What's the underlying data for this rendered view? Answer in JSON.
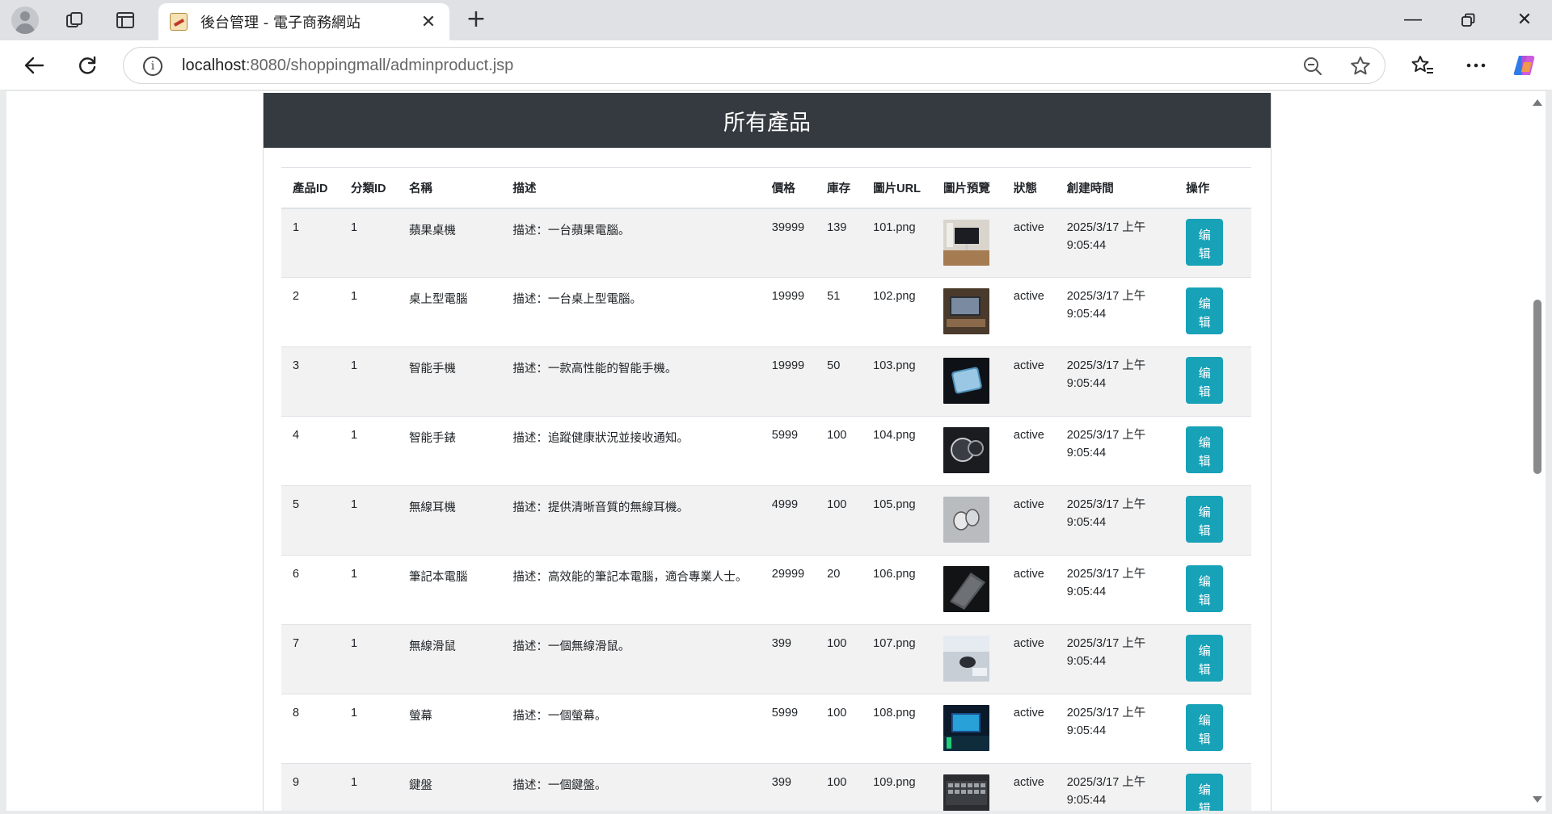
{
  "browser": {
    "tab_title": "後台管理 - 電子商務網站",
    "url_host": "localhost",
    "url_rest": ":8080/shoppingmall/adminproduct.jsp"
  },
  "page": {
    "heading": "所有產品"
  },
  "table": {
    "headers": [
      "產品ID",
      "分類ID",
      "名稱",
      "描述",
      "價格",
      "庫存",
      "圖片URL",
      "圖片預覽",
      "狀態",
      "創建時間",
      "操作"
    ],
    "rows": [
      {
        "id": "1",
        "cat": "1",
        "name": "蘋果桌機",
        "desc": "描述：一台蘋果電腦。",
        "price": "39999",
        "stock": "139",
        "img": "101.png",
        "status": "active",
        "time1": "2025/3/17 上午",
        "time2": "9:05:44",
        "action": "编辑",
        "thumb": "desk-photo-thumbnail"
      },
      {
        "id": "2",
        "cat": "1",
        "name": "桌上型電腦",
        "desc": "描述：一台桌上型電腦。",
        "price": "19999",
        "stock": "51",
        "img": "102.png",
        "status": "active",
        "time1": "2025/3/17 上午",
        "time2": "9:05:44",
        "action": "编辑",
        "thumb": "laptop-photo-thumbnail"
      },
      {
        "id": "3",
        "cat": "1",
        "name": "智能手機",
        "desc": "描述：一款高性能的智能手機。",
        "price": "19999",
        "stock": "50",
        "img": "103.png",
        "status": "active",
        "time1": "2025/3/17 上午",
        "time2": "9:05:44",
        "action": "编辑",
        "thumb": "phone-photo-thumbnail"
      },
      {
        "id": "4",
        "cat": "1",
        "name": "智能手錶",
        "desc": "描述：追蹤健康狀況並接收通知。",
        "price": "5999",
        "stock": "100",
        "img": "104.png",
        "status": "active",
        "time1": "2025/3/17 上午",
        "time2": "9:05:44",
        "action": "编辑",
        "thumb": "watch-photo-thumbnail"
      },
      {
        "id": "5",
        "cat": "1",
        "name": "無線耳機",
        "desc": "描述：提供清晰音質的無線耳機。",
        "price": "4999",
        "stock": "100",
        "img": "105.png",
        "status": "active",
        "time1": "2025/3/17 上午",
        "time2": "9:05:44",
        "action": "编辑",
        "thumb": "earbuds-photo-thumbnail"
      },
      {
        "id": "6",
        "cat": "1",
        "name": "筆記本電腦",
        "desc": "描述：高效能的筆記本電腦，適合專業人士。",
        "price": "29999",
        "stock": "20",
        "img": "106.png",
        "status": "active",
        "time1": "2025/3/17 上午",
        "time2": "9:05:44",
        "action": "编辑",
        "thumb": "notebook-photo-thumbnail"
      },
      {
        "id": "7",
        "cat": "1",
        "name": "無線滑鼠",
        "desc": "描述：一個無線滑鼠。",
        "price": "399",
        "stock": "100",
        "img": "107.png",
        "status": "active",
        "time1": "2025/3/17 上午",
        "time2": "9:05:44",
        "action": "编辑",
        "thumb": "mouse-photo-thumbnail"
      },
      {
        "id": "8",
        "cat": "1",
        "name": "螢幕",
        "desc": "描述：一個螢幕。",
        "price": "5999",
        "stock": "100",
        "img": "108.png",
        "status": "active",
        "time1": "2025/3/17 上午",
        "time2": "9:05:44",
        "action": "编辑",
        "thumb": "monitor-photo-thumbnail"
      },
      {
        "id": "9",
        "cat": "1",
        "name": "鍵盤",
        "desc": "描述：一個鍵盤。",
        "price": "399",
        "stock": "100",
        "img": "109.png",
        "status": "active",
        "time1": "2025/3/17 上午",
        "time2": "9:05:44",
        "action": "编辑",
        "thumb": "keyboard-photo-thumbnail"
      }
    ]
  },
  "colors": {
    "header_bg": "#343a40",
    "edit_button": "#17a2b8",
    "stripe": "#f2f2f2"
  }
}
